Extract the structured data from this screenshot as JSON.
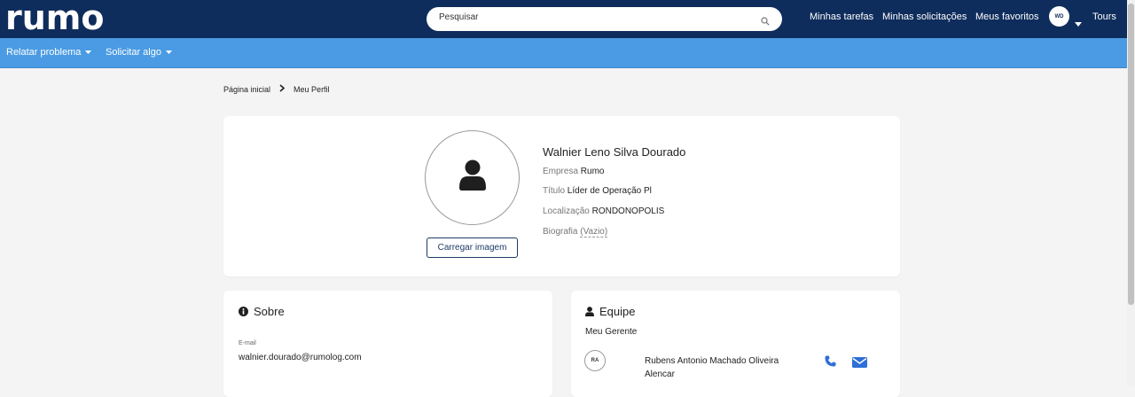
{
  "header": {
    "logo_text": "rumo",
    "search_placeholder": "Pesquisar",
    "nav": [
      "Minhas tarefas",
      "Minhas solicitações",
      "Meus favoritos"
    ],
    "avatar_initials": "WD",
    "tours_label": "Tours"
  },
  "subnav": {
    "items": [
      "Relatar problema",
      "Solicitar algo"
    ]
  },
  "breadcrumb": {
    "home": "Página inicial",
    "current": "Meu Perfil"
  },
  "profile": {
    "name": "Walnier Leno Silva Dourado",
    "upload_label": "Carregar imagem",
    "fields": [
      {
        "label": "Empresa",
        "value": "Rumo"
      },
      {
        "label": "Título",
        "value": "Líder de Operação Pl"
      },
      {
        "label": "Localização",
        "value": "RONDONOPOLIS"
      }
    ],
    "bio_label": "Biografia",
    "bio_value": "(Vazio)"
  },
  "about": {
    "title": "Sobre",
    "email_label": "E-mail",
    "email_value": "walnier.dourado@rumolog.com"
  },
  "team": {
    "title": "Equipe",
    "manager_title": "Meu Gerente",
    "manager_initials": "RA",
    "manager_name": "Rubens Antonio Machado Oliveira Alencar"
  },
  "colors": {
    "topbar": "#0f2d5c",
    "subbar": "#4a9be3",
    "accent_icon": "#2e6fd8"
  }
}
